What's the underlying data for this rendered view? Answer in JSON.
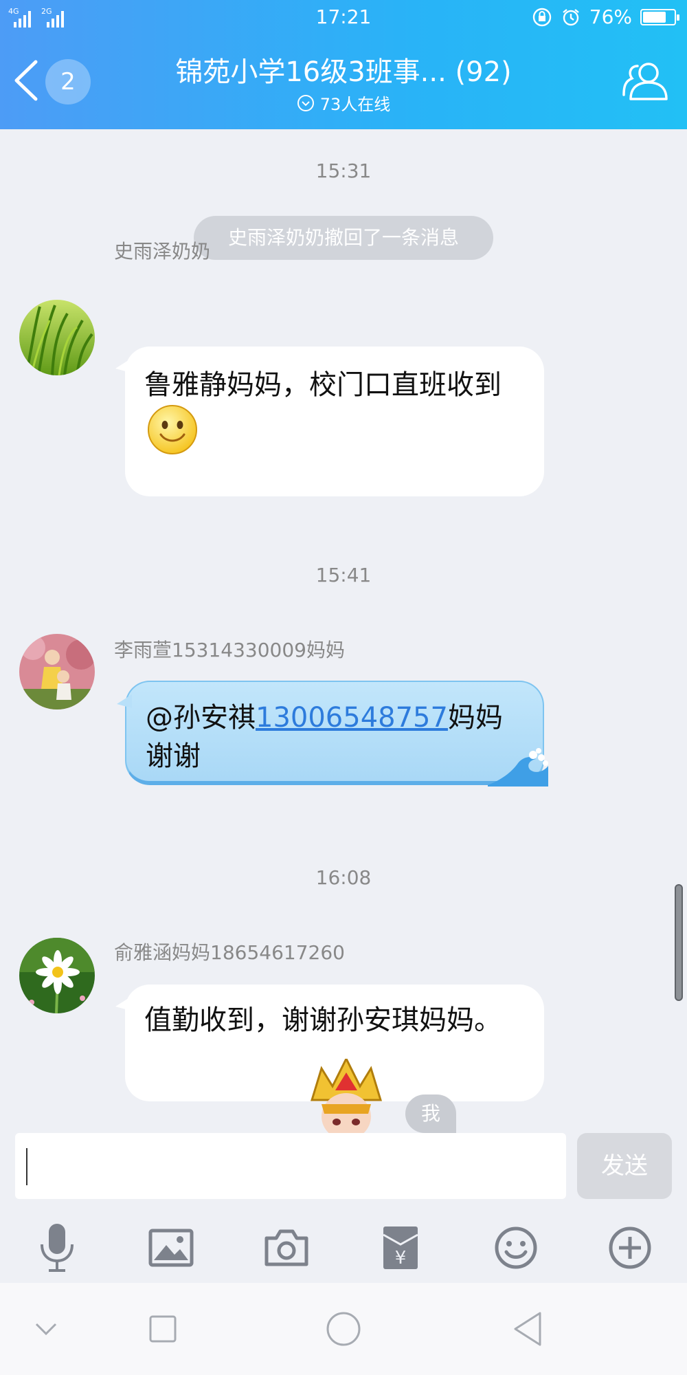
{
  "status_bar": {
    "network_1": "4G",
    "network_2": "2G",
    "time": "17:21",
    "battery_percent": "76%",
    "battery_level": 0.76
  },
  "header": {
    "back_badge_count": "2",
    "title": "锦苑小学16级3班事... (92)",
    "online_text": "73人在线",
    "accent_color": "#36a8f6"
  },
  "messages": [
    {
      "type": "timestamp",
      "text": "15:31"
    },
    {
      "type": "system",
      "text": "史雨泽奶奶撤回了一条消息"
    },
    {
      "type": "chat",
      "sender": "史雨泽奶奶",
      "text": "鲁雅静妈妈，校门口直班收到",
      "emoji": "smile-emoji",
      "avatar": "grass-avatar"
    },
    {
      "type": "timestamp",
      "text": "15:41"
    },
    {
      "type": "chat",
      "sender": "李雨萱15314330009妈妈",
      "text_prefix": "@孙安祺",
      "link": "13006548757",
      "text_suffix": "妈妈谢谢",
      "avatar": "children-photo-avatar",
      "style": "blue-wave"
    },
    {
      "type": "timestamp",
      "text": "16:08"
    },
    {
      "type": "chat",
      "sender": "俞雅涵妈妈18654617260",
      "text": "值勤收到，谢谢孙安琪妈妈。",
      "avatar": "daisy-avatar"
    }
  ],
  "sticker": {
    "icon": "warrior-sticker",
    "label": "我"
  },
  "input": {
    "value": "",
    "send_label": "发送"
  },
  "toolbar": {
    "icons": [
      "microphone-icon",
      "image-icon",
      "camera-icon",
      "red-packet-icon",
      "emoji-icon",
      "plus-icon"
    ]
  },
  "navbar": {
    "icons": [
      "chevron-down-icon",
      "recent-apps-icon",
      "home-icon",
      "back-triangle-icon"
    ]
  }
}
